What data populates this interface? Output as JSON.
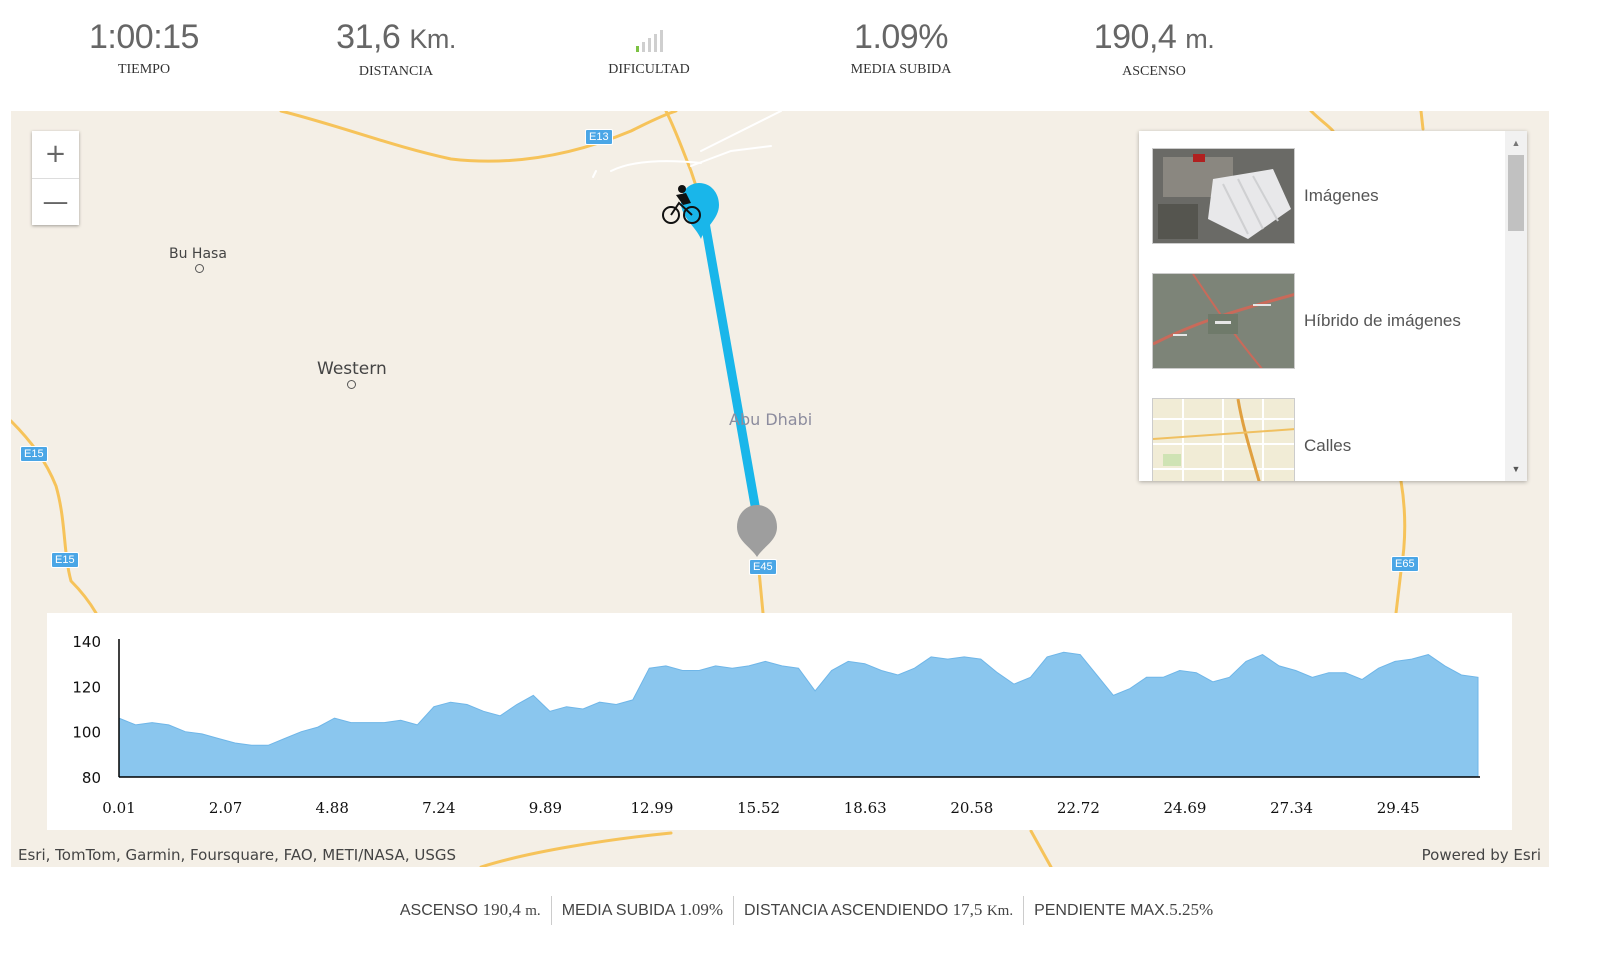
{
  "stats": [
    {
      "value": "1:00:15",
      "unit": "",
      "label": "TIEMPO"
    },
    {
      "value": "31,6",
      "unit": "Km.",
      "label": "DISTANCIA"
    },
    {
      "value": "",
      "unit": "",
      "label": "DIFICULTAD",
      "icon": "difficulty-signal-icon",
      "level_bars": 1,
      "total_bars": 5
    },
    {
      "value": "1.09%",
      "unit": "",
      "label": "MEDIA SUBIDA"
    },
    {
      "value": "190,4",
      "unit": "m.",
      "label": "ASCENSO"
    }
  ],
  "map": {
    "places": [
      {
        "name": "Bu Hasa"
      },
      {
        "name": "Western"
      },
      {
        "name": "Abu Dhabi"
      }
    ],
    "road_shields": [
      "E13",
      "E15",
      "E15",
      "E45",
      "E65"
    ],
    "route_color": "#19b6ea",
    "end_marker_color": "#9e9e9e",
    "zoom_in": "+",
    "zoom_out": "—"
  },
  "basemap_gallery": {
    "items": [
      {
        "label": "Imágenes"
      },
      {
        "label": "Híbrido de imágenes"
      },
      {
        "label": "Calles"
      }
    ]
  },
  "attribution": {
    "left": "Esri, TomTom, Garmin, Foursquare, FAO, METI/NASA, USGS",
    "right": "Powered by Esri"
  },
  "chart_data": {
    "type": "area",
    "title": "",
    "xlabel": "",
    "ylabel": "",
    "ylim": [
      80,
      140
    ],
    "yticks": [
      80,
      100,
      120,
      140
    ],
    "xtick_labels": [
      "0.01",
      "2.07",
      "4.88",
      "7.24",
      "9.89",
      "12.99",
      "15.52",
      "18.63",
      "20.58",
      "22.72",
      "24.69",
      "27.34",
      "29.45"
    ],
    "fill_color": "#8ac6ee",
    "series": [
      {
        "values": [
          106,
          103,
          104,
          103,
          100,
          99,
          97,
          95,
          94,
          94,
          97,
          100,
          102,
          106,
          104,
          104,
          104,
          105,
          103,
          111,
          113,
          112,
          109,
          107,
          112,
          116,
          109,
          111,
          110,
          113,
          112,
          114,
          128,
          129,
          127,
          127,
          129,
          128,
          129,
          131,
          129,
          128,
          118,
          127,
          131,
          130,
          127,
          125,
          128,
          133,
          132,
          133,
          132,
          126,
          121,
          124,
          133,
          135,
          134,
          125,
          116,
          119,
          124,
          124,
          127,
          126,
          122,
          124,
          131,
          134,
          129,
          127,
          124,
          126,
          126,
          123,
          128,
          131,
          132,
          134,
          129,
          125,
          124
        ]
      }
    ]
  },
  "summary": [
    {
      "label": "ASCENSO",
      "value": "190,4",
      "unit": "m."
    },
    {
      "label": "MEDIA SUBIDA",
      "value": "1.09%",
      "unit": ""
    },
    {
      "label": "DISTANCIA ASCENDIENDO",
      "value": "17,5",
      "unit": "Km."
    },
    {
      "label": "PENDIENTE MAX.",
      "value": "5.25%",
      "unit": ""
    }
  ]
}
